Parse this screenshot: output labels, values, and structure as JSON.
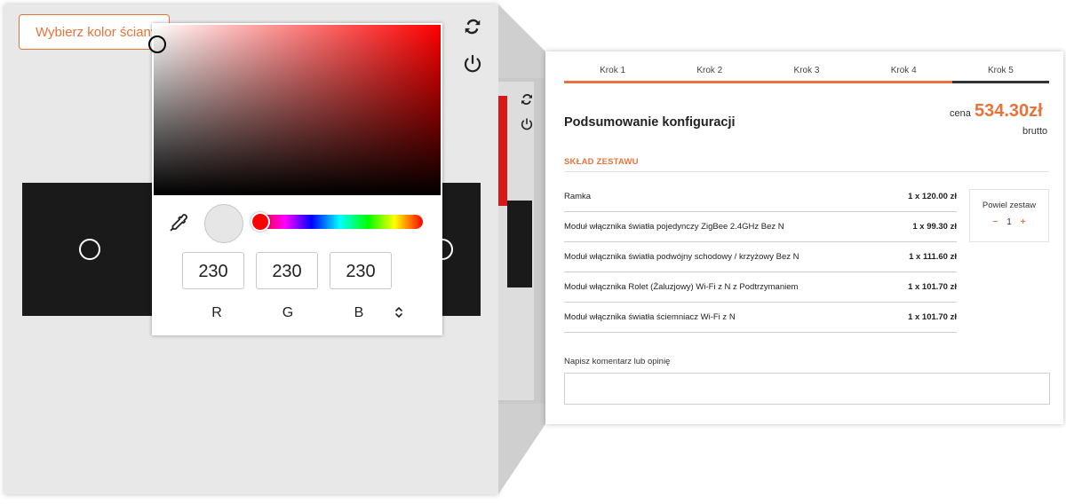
{
  "left": {
    "choose_wall_color_label": "Wybierz kolor ściany",
    "icons": [
      "refresh-icon",
      "power-icon"
    ]
  },
  "color_picker": {
    "current_color": "#e6e6e6",
    "hue_color": "#ff0000",
    "r": "230",
    "g": "230",
    "b": "230",
    "r_label": "R",
    "g_label": "G",
    "b_label": "B"
  },
  "summary": {
    "steps": [
      "Krok 1",
      "Krok 2",
      "Krok 3",
      "Krok 4",
      "Krok 5"
    ],
    "active_step": 5,
    "title": "Podsumowanie konfiguracji",
    "price_label": "cena",
    "price_value": "534.30zł",
    "price_note": "brutto",
    "section_title": "SKŁAD ZESTAWU",
    "items": [
      {
        "name": "Ramka",
        "qty": "1 x 120.00 zł"
      },
      {
        "name": "Moduł włącznika światła pojedynczy ZigBee 2.4GHz Bez N",
        "qty": "1 x 99.30 zł"
      },
      {
        "name": "Moduł włącznika światła podwójny schodowy / krzyżowy Bez N",
        "qty": "1 x 111.60 zł"
      },
      {
        "name": "Moduł włącznika Rolet (Żaluzjowy) Wi-Fi z N z Podtrzymaniem",
        "qty": "1 x 101.70 zł"
      },
      {
        "name": "Moduł włącznika światła ściemniacz Wi-Fi z N",
        "qty": "1 x 101.70 zł"
      }
    ],
    "repeat_label": "Powiel zestaw",
    "repeat_minus": "−",
    "repeat_count": "1",
    "repeat_plus": "+",
    "comment_label": "Napisz komentarz lub opinię",
    "comment_value": ""
  },
  "colors": {
    "accent": "#e8733a",
    "frame_dark": "#1a1a1a"
  }
}
